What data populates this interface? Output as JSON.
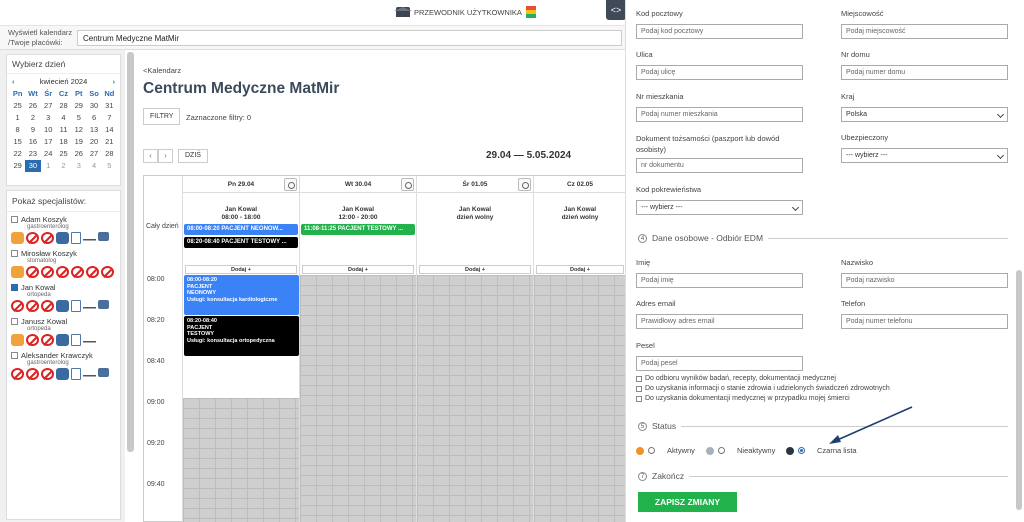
{
  "top": {
    "guide_label": "PRZEWODNIK UŻYTKOWNIKA",
    "calendar_label": "Wyświetl kalendarz /Twoje placówki:",
    "calendar_value": "Centrum Medyczne MatMir",
    "toggle": "<>"
  },
  "minical": {
    "title": "Wybierz dzień",
    "month": "kwiecień 2024",
    "prev": "‹",
    "next": "›",
    "daynames": [
      "Pn",
      "Wt",
      "Śr",
      "Cz",
      "Pt",
      "So",
      "Nd"
    ],
    "weeks": [
      [
        "25",
        "26",
        "27",
        "28",
        "29",
        "30",
        "31"
      ],
      [
        "1",
        "2",
        "3",
        "4",
        "5",
        "6",
        "7"
      ],
      [
        "8",
        "9",
        "10",
        "11",
        "12",
        "13",
        "14"
      ],
      [
        "15",
        "16",
        "17",
        "18",
        "19",
        "20",
        "21"
      ],
      [
        "22",
        "23",
        "24",
        "25",
        "26",
        "27",
        "28"
      ],
      [
        "29",
        "30",
        "1",
        "2",
        "3",
        "4",
        "5"
      ]
    ]
  },
  "specialists": {
    "title": "Pokaż specjalistów:",
    "items": [
      {
        "name": "Adam Koszyk",
        "role": "gastroenterolog"
      },
      {
        "name": "Mirosław Koszyk",
        "role": "stomatolog"
      },
      {
        "name": "Jan Kowal",
        "role": "ortopeda"
      },
      {
        "name": "Janusz Kowal",
        "role": "ortopeda"
      },
      {
        "name": "Aleksander Krawczyk",
        "role": "gastroenterolog"
      }
    ]
  },
  "main": {
    "back": "<Kalendarz",
    "title": "Centrum Medyczne MatMir",
    "filters_btn": "FILTRY",
    "filters_txt": "Zaznaczone filtry: 0",
    "prev": "‹",
    "next": "›",
    "today": "DZIŚ",
    "range": "29.04 — 5.05.2024",
    "allday": "Cały dzień",
    "add": "Dodaj +",
    "days": [
      {
        "head": "Pn 29.04",
        "doc": "Jan Kowal",
        "hours": "08:00 - 18:00"
      },
      {
        "head": "Wt 30.04",
        "doc": "Jan Kowal",
        "hours": "12:00 - 20:00"
      },
      {
        "head": "Śr 01.05",
        "doc": "Jan Kowal",
        "hours": "dzień wolny"
      },
      {
        "head": "Cz 02.05",
        "doc": "Jan Kowal",
        "hours": "dzień wolny"
      }
    ],
    "times": [
      "08:00",
      "08:20",
      "08:40",
      "09:00",
      "09:20",
      "09:40"
    ],
    "allday_events": {
      "e1": "08:00-08:20 PACJENT NEONOW...",
      "e2": "08:20-08:40 PACJENT TESTOWY ...",
      "e3": "11:08-11:25 PACJENT TESTOWY ..."
    },
    "slot1": {
      "time": "08:00-08:20",
      "l1": "PACJENT",
      "l2": "NEONOWY",
      "l3": "Usługi: konsultacja kardiologiczne"
    },
    "slot2": {
      "time": "08:20-08:40",
      "l1": "PACJENT",
      "l2": "TESTOWY",
      "l3": "Usługi: konsultacja ortopedyczna"
    }
  },
  "form": {
    "postal_label": "Kod pocztowy",
    "postal_ph": "Podaj kod pocztowy",
    "city_label": "Miejscowość",
    "city_ph": "Podaj miejscowość",
    "street_label": "Ulica",
    "street_ph": "Podaj ulicę",
    "house_label": "Nr domu",
    "house_ph": "Podaj numer domu",
    "flat_label": "Nr mieszkania",
    "flat_ph": "Podaj numer mieszkania",
    "country_label": "Kraj",
    "country_value": "Polska",
    "doc_label": "Dokument tożsamości (paszport lub dowód osobisty)",
    "doc_ph": "nr dokumentu",
    "insured_label": "Ubezpieczony",
    "insured_value": "--- wybierz ---",
    "kin_label": "Kod pokrewieństwa",
    "kin_value": "--- wybierz ---",
    "sec4_num": "4",
    "sec4": "Dane osobowe - Odbiór EDM",
    "fname_label": "Imię",
    "fname_ph": "Podaj imię",
    "lname_label": "Nazwisko",
    "lname_ph": "Podaj nazwisko",
    "email_label": "Adres email",
    "email_ph": "Prawidłowy adres email",
    "phone_label": "Telefon",
    "phone_ph": "Podaj numer telefonu",
    "pesel_label": "Pesel",
    "pesel_ph": "Podaj pesel",
    "consent1": "Do odbioru wyników badań, recepty, dokumentacji medycznej",
    "consent2": "Do uzyskania informacji o stanie zdrowia i udzielonych świadczeń zdrowotnych",
    "consent3": "Do uzyskania dokumentacji medycznej w przypadku mojej śmierci",
    "sec5_num": "5",
    "sec5": "Status",
    "status_active": "Aktywny",
    "status_inactive": "Nieaktywny",
    "status_black": "Czarna lista",
    "sec7_num": "7",
    "sec7": "Zakończ",
    "save": "ZAPISZ ZMIANY"
  },
  "colors": {
    "active": "#f0932b",
    "inactive": "#a7b1bc",
    "black": "#2c3440",
    "blue_event": "#3b82f6",
    "green_event": "#22b24c",
    "save": "#22b24c"
  }
}
